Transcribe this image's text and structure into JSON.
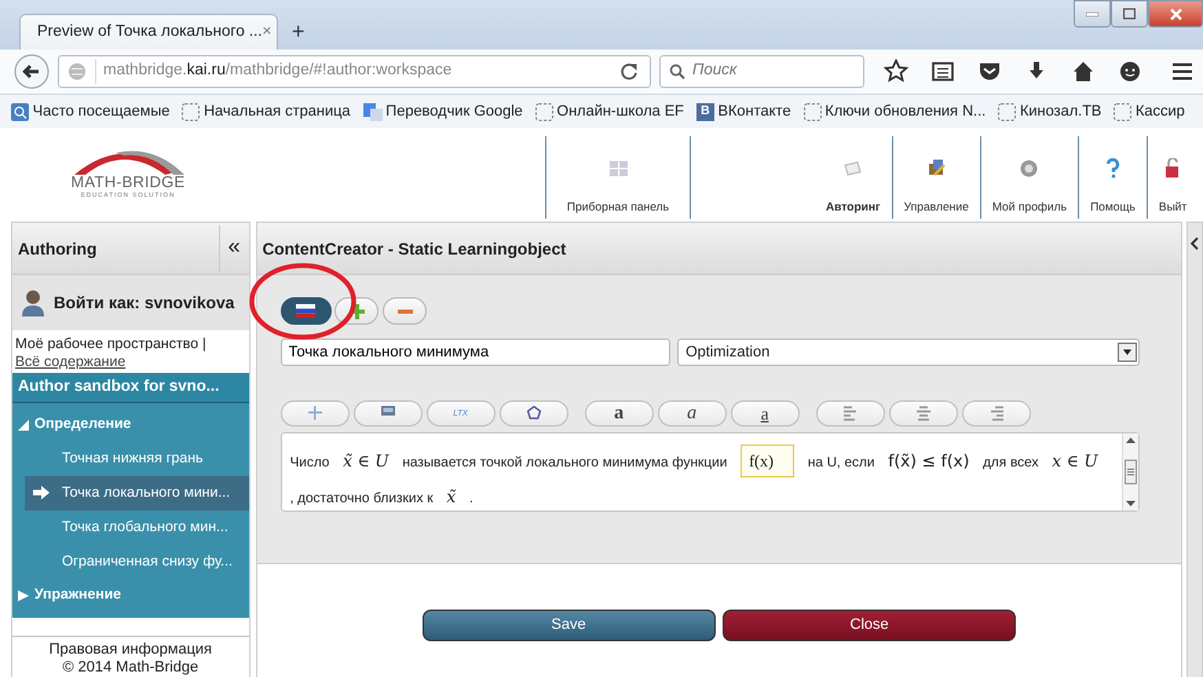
{
  "browser": {
    "tab": {
      "title": "Preview of Точка локального ...",
      "close": "×"
    },
    "new_tab": "+",
    "url": {
      "prefix": "mathbridge.",
      "domain": "kai.ru",
      "path": "/mathbridge/#!author:workspace"
    },
    "search": {
      "placeholder": "Поиск"
    }
  },
  "bookmarks": [
    {
      "kind": "search",
      "label": "Часто посещаемые"
    },
    {
      "kind": "page",
      "label": "Начальная страница"
    },
    {
      "kind": "translate",
      "label": "Переводчик Google"
    },
    {
      "kind": "page",
      "label": "Онлайн-школа EF"
    },
    {
      "kind": "vk",
      "badge": "В",
      "label": "ВКонтакте"
    },
    {
      "kind": "page",
      "label": "Ключи обновления N..."
    },
    {
      "kind": "page",
      "label": "Кинозал.ТВ"
    },
    {
      "kind": "page",
      "label": "Кассир"
    }
  ],
  "logo": {
    "title": "MATH-BRIDGE",
    "subtitle": "EDUCATION SOLUTION"
  },
  "nav": [
    {
      "kind": "dashboard",
      "label": "Приборная панель",
      "selected": false
    },
    {
      "kind": "authoring",
      "label": "Авторинг",
      "selected": true
    },
    {
      "kind": "manage",
      "label": "Управление",
      "selected": false
    },
    {
      "kind": "profile",
      "label": "Мой профиль",
      "selected": false
    },
    {
      "kind": "help",
      "label": "Помощь",
      "selected": false
    },
    {
      "kind": "logout",
      "label": "Выйт",
      "selected": false
    }
  ],
  "sidebar": {
    "title": "Authoring",
    "collapse": "«",
    "user": "Войти как: svnovikova",
    "workspace": {
      "text": "Моё рабочее пространство |",
      "link": "Всё содержание"
    },
    "sandbox": "Author sandbox for svno...",
    "tree": [
      {
        "label": "Определение",
        "expanded": true,
        "children": [
          {
            "label": "Точная нижняя грань",
            "selected": false
          },
          {
            "label": "Точка локального мини...",
            "selected": true
          },
          {
            "label": "Точка глобального мин...",
            "selected": false
          },
          {
            "label": "Ограниченная снизу фу...",
            "selected": false
          }
        ]
      },
      {
        "label": "Упражнение",
        "expanded": false
      }
    ],
    "footer": [
      "Правовая информация",
      "© 2014 Math-Bridge"
    ]
  },
  "editor": {
    "title": "ContentCreator - Static Learningobject",
    "lang_buttons": [
      {
        "kind": "flag",
        "selected": true
      },
      {
        "kind": "add",
        "selected": false
      },
      {
        "kind": "remove",
        "selected": false
      }
    ],
    "title_field": {
      "value": "Точка локального минимума"
    },
    "category": {
      "value": "Optimization"
    },
    "toolbar": [
      {
        "kind": "plus"
      },
      {
        "kind": "image"
      },
      {
        "kind": "latex",
        "label": "LTX"
      },
      {
        "kind": "shape"
      },
      {
        "kind": "bold",
        "label": "a"
      },
      {
        "kind": "italic",
        "label": "a"
      },
      {
        "kind": "underline",
        "label": "a"
      },
      {
        "kind": "align-left"
      },
      {
        "kind": "align-center"
      },
      {
        "kind": "align-right"
      }
    ],
    "content": [
      {
        "kind": "text",
        "text": "Число"
      },
      {
        "kind": "math",
        "text": "x̃ ∈ U"
      },
      {
        "kind": "text",
        "text": "называется точкой локального минимума функции"
      },
      {
        "kind": "formula",
        "text": "f(x)"
      },
      {
        "kind": "text",
        "text": "на U, если"
      },
      {
        "kind": "math-upright",
        "text": "f(x̃) ≤ f(x)"
      },
      {
        "kind": "text",
        "text": "для всех"
      },
      {
        "kind": "math",
        "text": "x ∈ U"
      },
      {
        "kind": "text",
        "text": ", достаточно близких к"
      },
      {
        "kind": "math",
        "text": "x̃"
      },
      {
        "kind": "text",
        "text": "."
      }
    ],
    "actions": [
      {
        "kind": "save",
        "label": "Save"
      },
      {
        "kind": "close",
        "label": "Close"
      }
    ]
  },
  "annotation": {
    "kind": "ellipse"
  }
}
